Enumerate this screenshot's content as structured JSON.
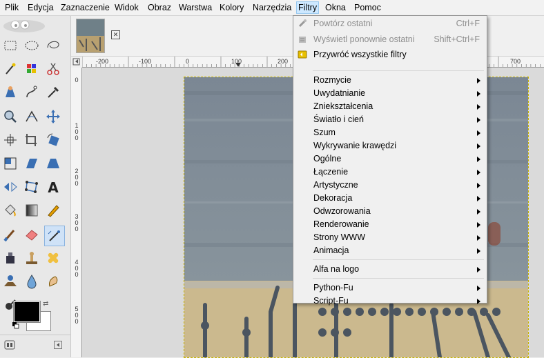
{
  "menubar": {
    "items": [
      {
        "label": "Plik",
        "active": false
      },
      {
        "label": "Edycja",
        "active": false
      },
      {
        "label": "Zaznaczenie",
        "active": false
      },
      {
        "label": "Widok",
        "active": false
      },
      {
        "label": "Obraz",
        "active": false
      },
      {
        "label": "Warstwa",
        "active": false
      },
      {
        "label": "Kolory",
        "active": false
      },
      {
        "label": "Narzędzia",
        "active": false
      },
      {
        "label": "Filtry",
        "active": true
      },
      {
        "label": "Okna",
        "active": false
      },
      {
        "label": "Pomoc",
        "active": false
      }
    ]
  },
  "rulers": {
    "h_ticks": [
      "-200",
      "-100",
      "0",
      "100",
      "200",
      "700"
    ],
    "v_ticks": [
      "0",
      "1\n0\n0",
      "2\n0\n0",
      "3\n0\n0",
      "4\n0\n0",
      "5\n0\n0"
    ]
  },
  "filters_menu": {
    "top_items": [
      {
        "label": "Powtórz ostatni",
        "shortcut": "Ctrl+F",
        "disabled": true,
        "icon": "repeat-icon"
      },
      {
        "label": "Wyświetl ponownie ostatni",
        "shortcut": "Shift+Ctrl+F",
        "disabled": true,
        "icon": "reshow-icon"
      },
      {
        "label": "Przywróć wszystkie filtry",
        "shortcut": "",
        "disabled": false,
        "icon": "reset-filters-icon"
      }
    ],
    "group1": [
      "Rozmycie",
      "Uwydatnianie",
      "Zniekształcenia",
      "Światło i cień",
      "Szum",
      "Wykrywanie krawędzi",
      "Ogólne",
      "Łączenie",
      "Artystyczne",
      "Dekoracja",
      "Odwzorowania",
      "Renderowanie",
      "Strony WWW",
      "Animacja"
    ],
    "group2": [
      "Alfa na logo"
    ],
    "group3": [
      "Python-Fu",
      "Script-Fu"
    ]
  },
  "colors": {
    "accent_active_menu": "#cde8ff",
    "foreground": "#000000",
    "background": "#ffffff"
  }
}
